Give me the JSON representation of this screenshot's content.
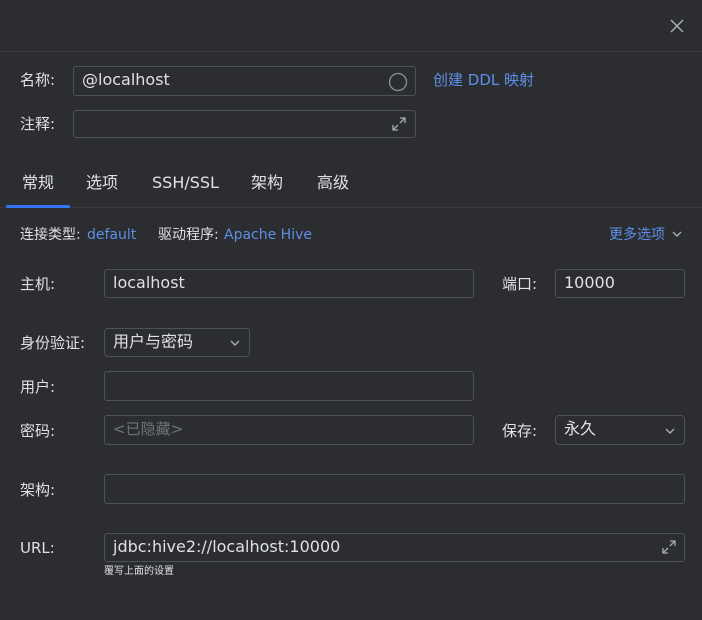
{
  "colors": {
    "background": "#2b2d30",
    "border": "#4e5157",
    "link": "#5e8fe8",
    "tab_active": "#3574f0",
    "text": "#dfe1e5",
    "placeholder": "#6f737a"
  },
  "header": {
    "close_icon": "close-icon"
  },
  "top": {
    "name_label": "名称:",
    "name_value": "@localhost",
    "color_picker_icon": "circle-icon",
    "ddl_mapping_link": "创建 DDL 映射",
    "comment_label": "注释:",
    "comment_value": "",
    "expand_icon": "expand-icon"
  },
  "tabs": [
    {
      "label": "常规",
      "active": true
    },
    {
      "label": "选项",
      "active": false
    },
    {
      "label": "SSH/SSL",
      "active": false
    },
    {
      "label": "架构",
      "active": false
    },
    {
      "label": "高级",
      "active": false
    }
  ],
  "general": {
    "connection_type_label": "连接类型:",
    "connection_type_value": "default",
    "driver_label": "驱动程序:",
    "driver_value": "Apache Hive",
    "more_options": "更多选项",
    "host_label": "主机:",
    "host_value": "localhost",
    "port_label": "端口:",
    "port_value": "10000",
    "auth_label": "身份验证:",
    "auth_value": "用户与密码",
    "user_label": "用户:",
    "user_value": "",
    "password_label": "密码:",
    "password_placeholder": "<已隐藏>",
    "save_label": "保存:",
    "save_value": "永久",
    "schema_label": "架构:",
    "schema_value": "",
    "url_label": "URL:",
    "url_value": "jdbc:hive2://localhost:10000",
    "url_hint": "覆写上面的设置"
  }
}
